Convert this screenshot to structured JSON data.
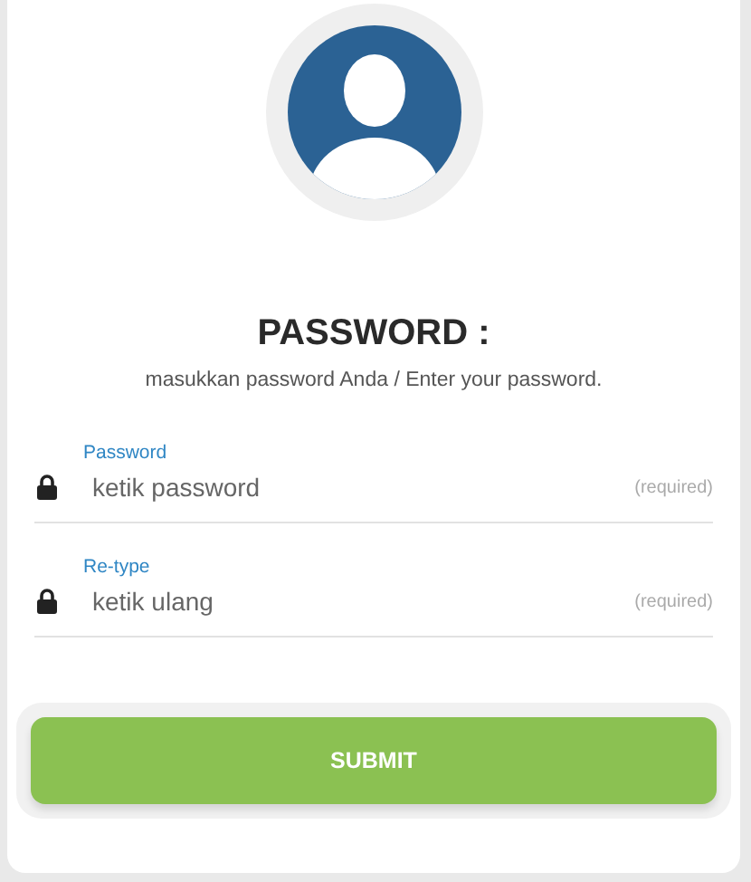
{
  "title": "PASSWORD :",
  "subtitle": "masukkan password Anda / Enter your password.",
  "fields": [
    {
      "label": "Password",
      "placeholder": "ketik password",
      "hint": "(required)"
    },
    {
      "label": "Re-type",
      "placeholder": "ketik ulang",
      "hint": "(required)"
    }
  ],
  "submit": {
    "label": "SUBMIT"
  }
}
